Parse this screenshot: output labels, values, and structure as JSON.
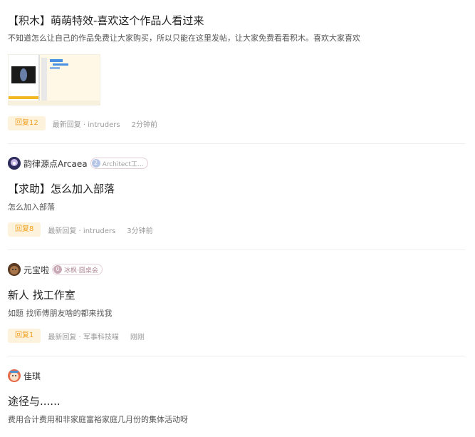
{
  "posts": [
    {
      "title": "【积木】萌萌特效-喜欢这个作品人看过来",
      "desc": "不知道怎么让自己的作品免费让大家购买，所以只能在这里发帖，让大家免费看看积木。喜欢大家喜欢",
      "reply": "回复12",
      "latest": "最新回复 · intruders",
      "time": "2分钟前"
    },
    {
      "author": "韵律源点Arcaea",
      "badge_num": "2",
      "badge_text": "Architect工...",
      "title": "【求助】怎么加入部落",
      "desc": "怎么加入部落",
      "reply": "回复8",
      "latest": "最新回复 · intruders",
      "time": "3分钟前"
    },
    {
      "author": "元宝啦",
      "badge_num": "0",
      "badge_text": "冰枫·圆桌会",
      "title": "新人 找工作室",
      "desc": "如题 找师傅朋友啥的都来找我",
      "reply": "回复1",
      "latest": "最新回复 · 军事科技喵",
      "time": "刚刚"
    },
    {
      "author": "佳琪",
      "title": "途径与......",
      "desc": "费用合计费用和非家庭富裕家庭几月份的集体活动呀"
    }
  ]
}
